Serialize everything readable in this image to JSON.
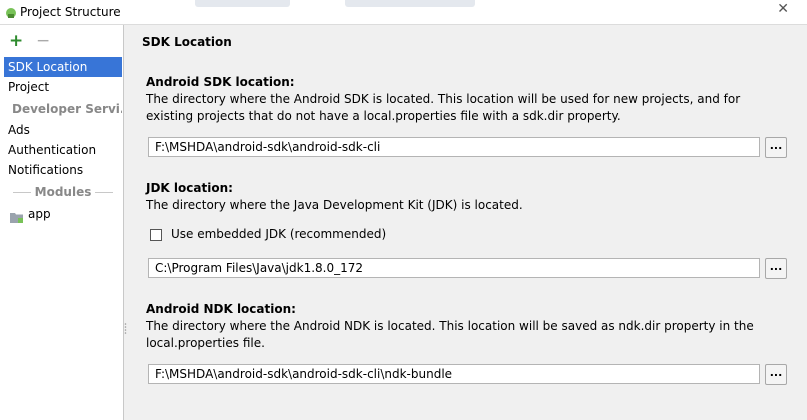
{
  "window": {
    "title": "Project Structure",
    "close_glyph": "✕"
  },
  "toolbar": {
    "add_glyph": "+",
    "remove_glyph": "−"
  },
  "sidebar": {
    "items": [
      {
        "label": "SDK Location",
        "selected": true
      },
      {
        "label": "Project"
      }
    ],
    "developer_services": {
      "header": "Developer Servi...",
      "items": [
        {
          "label": "Ads"
        },
        {
          "label": "Authentication"
        },
        {
          "label": "Notifications"
        }
      ]
    },
    "modules": {
      "header": "Modules",
      "items": [
        {
          "label": "app",
          "icon": "module-folder-icon"
        }
      ]
    }
  },
  "main": {
    "title": "SDK Location",
    "android_sdk": {
      "label": "Android SDK location:",
      "description": "The directory where the Android SDK is located. This location will be used for new projects, and for existing projects that do not have a local.properties file with a sdk.dir property.",
      "path": "F:\\MSHDA\\android-sdk\\android-sdk-cli",
      "browse": "..."
    },
    "jdk": {
      "label": "JDK location:",
      "description": "The directory where the Java Development Kit (JDK) is located.",
      "embedded_label": "Use embedded JDK (recommended)",
      "embedded_checked": false,
      "path": "C:\\Program Files\\Java\\jdk1.8.0_172",
      "browse": "..."
    },
    "android_ndk": {
      "label": "Android NDK location:",
      "description": "The directory where the Android NDK is located. This location will be saved as ndk.dir property in the local.properties file.",
      "path": "F:\\MSHDA\\android-sdk\\android-sdk-cli\\ndk-bundle",
      "browse": "..."
    }
  },
  "colors": {
    "selection": "#3875d7",
    "add": "#2e8b2e",
    "android": "#78c257"
  }
}
